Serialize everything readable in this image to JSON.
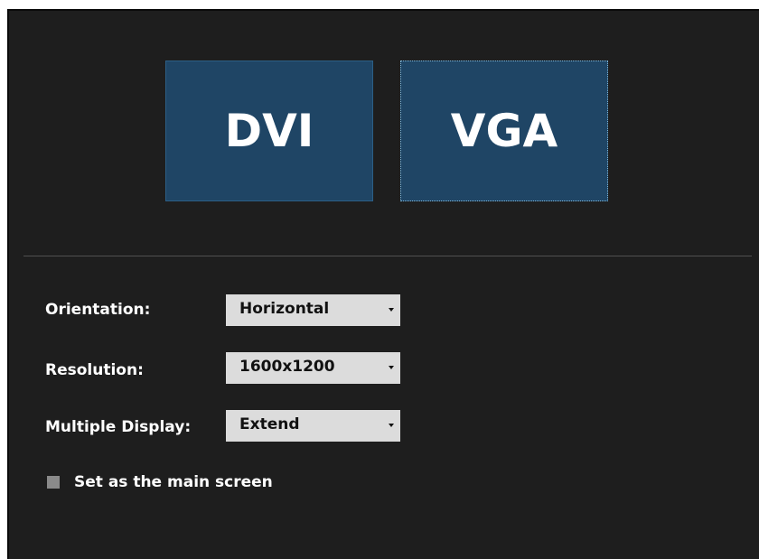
{
  "monitors": [
    {
      "label": "DVI"
    },
    {
      "label": "VGA"
    }
  ],
  "settings": {
    "orientation": {
      "label": "Orientation:",
      "value": "Horizontal"
    },
    "resolution": {
      "label": "Resolution:",
      "value": "1600x1200"
    },
    "multiple_display": {
      "label": "Multiple Display:",
      "value": "Extend"
    }
  },
  "main_screen": {
    "label": "Set as the main screen",
    "checked": false
  },
  "colors": {
    "panel_bg": "#1e1e1e",
    "monitor_bg": "#1f4565",
    "select_bg": "#dcdcdc",
    "selected_outline": "#7fb6d8"
  }
}
